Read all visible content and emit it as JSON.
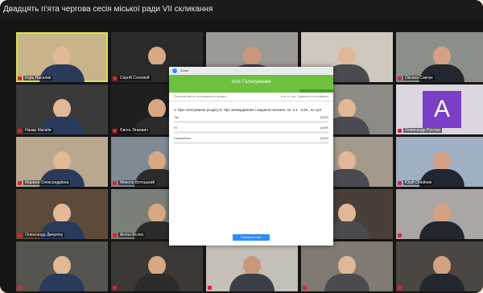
{
  "window": {
    "title": "Двадцять п'ята чергова сесія міської ради VII скликання"
  },
  "participants": [
    {
      "name": "Ігорь Насалик",
      "active": true
    },
    {
      "name": "Сергій Соловей",
      "active": false
    },
    {
      "name": "",
      "active": false
    },
    {
      "name": "",
      "active": false
    },
    {
      "name": "Оксана Савчук",
      "active": false
    },
    {
      "name": "Назар Матвіїв",
      "active": false
    },
    {
      "name": "Євген Зінкевич",
      "active": false
    },
    {
      "name": "",
      "active": false
    },
    {
      "name": "",
      "active": false
    },
    {
      "name": "Олександр Руслан",
      "active": false,
      "avatar_letter": "A"
    },
    {
      "name": "Марина Олександрівна",
      "active": false
    },
    {
      "name": "Микола Ботоцький",
      "active": false
    },
    {
      "name": "",
      "active": false
    },
    {
      "name": "",
      "active": false
    },
    {
      "name": "Юрій Олейник",
      "active": false
    },
    {
      "name": "Олександр Джеряну",
      "active": false
    },
    {
      "name": "Антон Бєлих",
      "active": false
    },
    {
      "name": "",
      "active": false
    },
    {
      "name": "",
      "active": false
    },
    {
      "name": "",
      "active": false
    },
    {
      "name": "",
      "active": false
    },
    {
      "name": "",
      "active": false
    },
    {
      "name": "",
      "active": false
    },
    {
      "name": "",
      "active": false
    },
    {
      "name": "",
      "active": false
    }
  ],
  "poll": {
    "window_title": "Zoom",
    "header_title": "Іллє Голосування",
    "subbar_left": "Поточний звіт по голосуванню в процесі",
    "subbar_right": "8 хв 12 сек | Тривалість голосування",
    "question": "1. Про голосування розділу 5. Про затвердження і надання питання, по: 3.1 - 3.26 , по суті",
    "options": [
      {
        "label": "Так",
        "percent_text": "(0)0%",
        "fraction": 0
      },
      {
        "label": "Ні",
        "percent_text": "(0)0%",
        "fraction": 0
      },
      {
        "label": "Утримались",
        "percent_text": "(0)0%",
        "fraction": 0
      }
    ],
    "share_button": "Поширити звіт"
  },
  "colors": {
    "poll_header": "#6ec13d",
    "active_speaker_border": "#d7e24a",
    "zoom_blue": "#2d8cff",
    "avatar_purple": "#7a3ec7"
  }
}
